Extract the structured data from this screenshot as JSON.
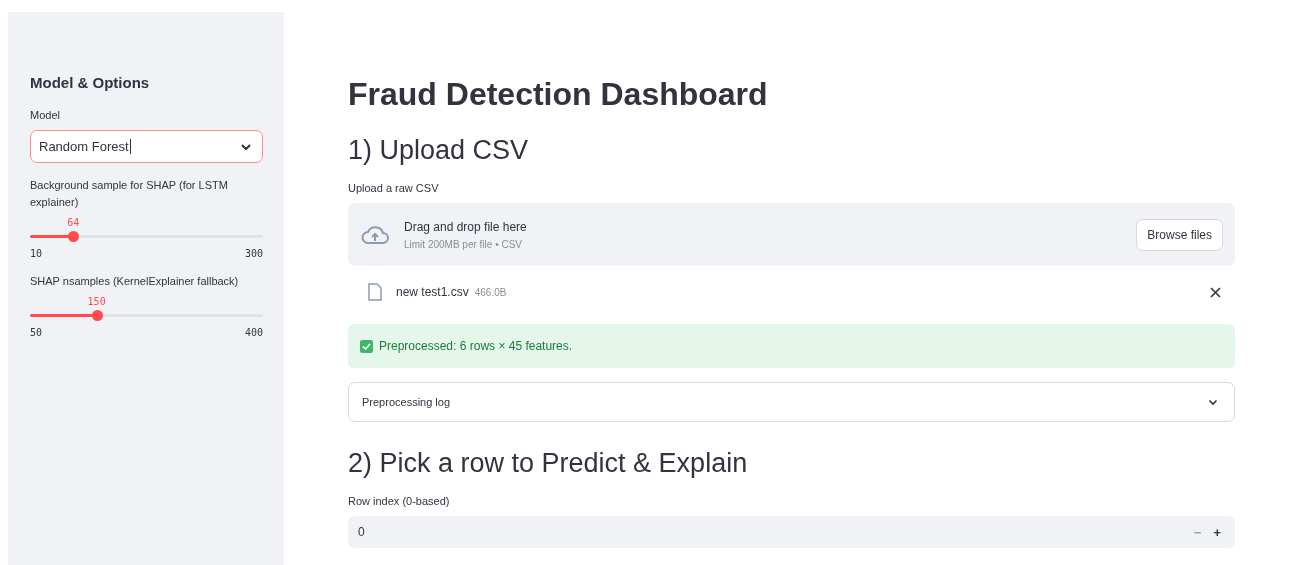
{
  "sidebar": {
    "title": "Model & Options",
    "model_select": {
      "label": "Model",
      "value": "Random Forest"
    },
    "sliders": [
      {
        "label": "Background sample for SHAP (for LSTM explainer)",
        "reading": "64",
        "min": "10",
        "max": "300",
        "level": 0.186
      },
      {
        "label": "SHAP nsamples (KernelExplainer fallback)",
        "reading": "150",
        "min": "50",
        "max": "400",
        "level": 0.286
      }
    ]
  },
  "main": {
    "title": "Fraud Detection Dashboard",
    "upload_section": {
      "heading": "1) Upload CSV",
      "label": "Upload a raw CSV",
      "dropzone_text": "Drag and drop file here",
      "dropzone_hint": "Limit 200MB per file • CSV",
      "browse_button": "Browse files",
      "file": {
        "name": "new test1.csv",
        "size": "466.0B"
      }
    },
    "success_message": "Preprocessed: 6 rows × 45 features.",
    "expander": {
      "label": "Preprocessing log",
      "expanded": false
    },
    "predict_section": {
      "heading": "2) Pick a row to Predict & Explain",
      "field_label": "Row index (0-based)",
      "value": "0",
      "decrement": {
        "symbol": "−",
        "disabled": true
      },
      "increment": {
        "symbol": "+",
        "disabled": false
      }
    }
  }
}
